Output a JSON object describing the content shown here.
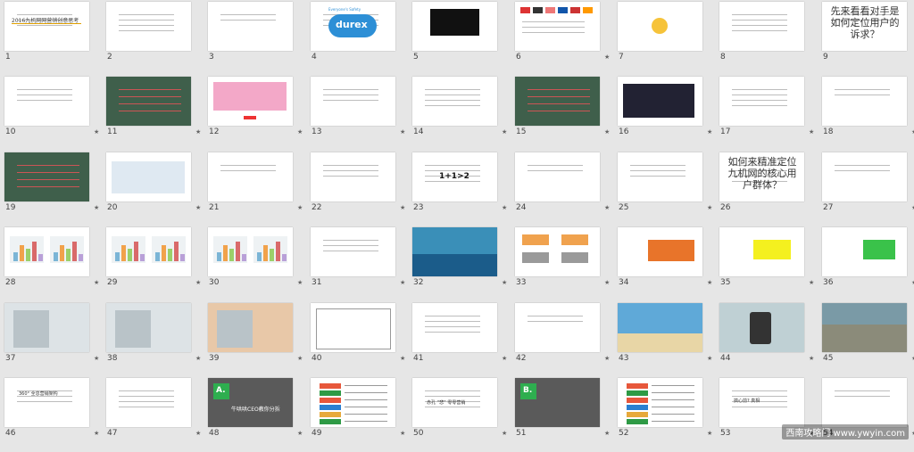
{
  "slides": [
    {
      "num": "1",
      "star": "",
      "title": "2016九机网网营销创意思考"
    },
    {
      "num": "2",
      "star": ""
    },
    {
      "num": "3",
      "star": ""
    },
    {
      "num": "4",
      "star": "",
      "logo": "durex",
      "logo_sub": "Everyone's Safety"
    },
    {
      "num": "5",
      "star": ""
    },
    {
      "num": "6",
      "star": "★"
    },
    {
      "num": "7",
      "star": ""
    },
    {
      "num": "8",
      "star": ""
    },
    {
      "num": "9",
      "star": "",
      "big_text": "先来看看对手是如何定位用户的诉求？"
    },
    {
      "num": "10",
      "star": "★"
    },
    {
      "num": "11",
      "star": "★"
    },
    {
      "num": "12",
      "star": "★"
    },
    {
      "num": "13",
      "star": "★"
    },
    {
      "num": "14",
      "star": "★"
    },
    {
      "num": "15",
      "star": "★"
    },
    {
      "num": "16",
      "star": "★"
    },
    {
      "num": "17",
      "star": "★"
    },
    {
      "num": "18",
      "star": "★"
    },
    {
      "num": "19",
      "star": "★"
    },
    {
      "num": "20",
      "star": "★"
    },
    {
      "num": "21",
      "star": "★"
    },
    {
      "num": "22",
      "star": "★"
    },
    {
      "num": "23",
      "star": "★",
      "formula": "1+1>2"
    },
    {
      "num": "24",
      "star": "★"
    },
    {
      "num": "25",
      "star": "★"
    },
    {
      "num": "26",
      "star": "",
      "big_text": "如何来精准定位九机网的核心用户群体？"
    },
    {
      "num": "27",
      "star": "★"
    },
    {
      "num": "28",
      "star": "★"
    },
    {
      "num": "29",
      "star": "★"
    },
    {
      "num": "30",
      "star": "★"
    },
    {
      "num": "31",
      "star": "★"
    },
    {
      "num": "32",
      "star": "★"
    },
    {
      "num": "33",
      "star": "★"
    },
    {
      "num": "34",
      "star": "★"
    },
    {
      "num": "35",
      "star": "★"
    },
    {
      "num": "36",
      "star": "★"
    },
    {
      "num": "37",
      "star": "★"
    },
    {
      "num": "38",
      "star": "★"
    },
    {
      "num": "39",
      "star": "★"
    },
    {
      "num": "40",
      "star": "★"
    },
    {
      "num": "41",
      "star": "★"
    },
    {
      "num": "42",
      "star": "★"
    },
    {
      "num": "43",
      "star": "★"
    },
    {
      "num": "44",
      "star": "★"
    },
    {
      "num": "45",
      "star": "★"
    },
    {
      "num": "46",
      "star": "★",
      "title": "360°  全息营销架构"
    },
    {
      "num": "47",
      "star": "★"
    },
    {
      "num": "48",
      "star": "★",
      "badge": "A.",
      "banner": "牛哄哄CEO教你分拆"
    },
    {
      "num": "49",
      "star": "★"
    },
    {
      "num": "50",
      "star": "★",
      "title": "赤孔 “悲” 零零营销"
    },
    {
      "num": "51",
      "star": "★",
      "badge": "B."
    },
    {
      "num": "52",
      "star": "★"
    },
    {
      "num": "53",
      "star": "★",
      "title": "搞心前? 真相"
    },
    {
      "num": "54",
      "star": "★"
    }
  ],
  "watermark": "西南攻略门 www.ywyin.com"
}
